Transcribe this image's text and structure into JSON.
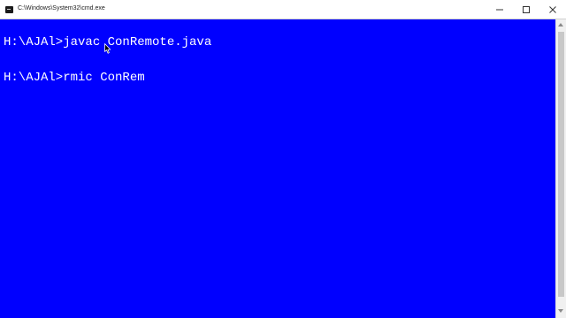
{
  "window": {
    "title": "C:\\Windows\\System32\\cmd.exe",
    "background": "#0000ff",
    "foreground": "#ffffff"
  },
  "controls": {
    "minimize_icon": "minimize-icon",
    "maximize_icon": "maximize-icon",
    "close_icon": "close-icon"
  },
  "terminal": {
    "lines": [
      "H:\\AJAl>javac ConRemote.java",
      "",
      "H:\\AJAl>rmic ConRem"
    ]
  },
  "icons": {
    "app": "console-app-icon",
    "mouse": "mouse-pointer-icon"
  }
}
